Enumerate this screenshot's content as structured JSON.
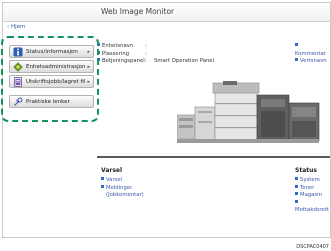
{
  "header": {
    "title": "Web Image Monitor"
  },
  "nav": {
    "home": "Hjem"
  },
  "sidebar": {
    "items": [
      {
        "label": "Status/informasjon",
        "icon": "info-icon"
      },
      {
        "label": "Enhetsadministrasjon",
        "icon": "device-management-icon"
      },
      {
        "label": "Utskriftsjobb/lagret fil",
        "icon": "print-job-icon"
      },
      {
        "label": "Praktiske lenker",
        "icon": "links-icon"
      }
    ]
  },
  "device": {
    "rows": [
      {
        "key": "Enhetsnavn",
        "colon": ":",
        "value": ""
      },
      {
        "key": "Plassering",
        "colon": ":",
        "value": ""
      },
      {
        "key": "Betjeningspanel",
        "colon": ":",
        "value": "Smart Operation Panel"
      }
    ],
    "links": [
      "Kommentar",
      "Vertsnavn"
    ]
  },
  "varsel": {
    "title": "Varsel",
    "items": [
      "Varsel",
      "Meldinger",
      "(Jobkomentar)"
    ]
  },
  "status": {
    "title": "Status",
    "items": [
      "System",
      "Toner",
      "Magasin",
      "Mottaksbrett"
    ]
  },
  "footer": {
    "code": "DSCPAC0407"
  },
  "colors": {
    "accent": "#13945f",
    "link": "#3857a8",
    "info_icon": "#2d5db4"
  }
}
